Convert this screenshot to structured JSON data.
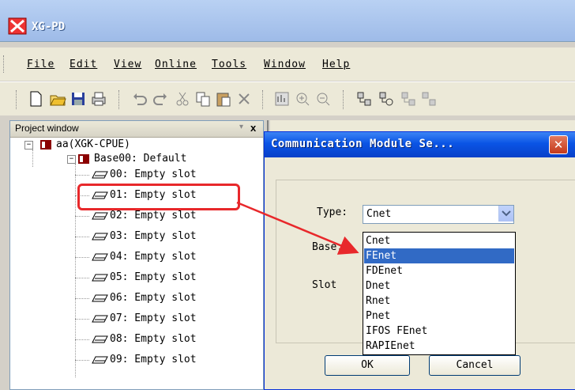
{
  "app": {
    "title": "XG-PD"
  },
  "menu": [
    "File",
    "Edit",
    "View",
    "Online",
    "Tools",
    "Window",
    "Help"
  ],
  "toolbar_icons": [
    "new-file-icon",
    "open-folder-icon",
    "save-icon",
    "print-icon",
    "undo-icon",
    "redo-icon",
    "cut-icon",
    "copy-icon",
    "paste-icon",
    "delete-icon",
    "monitor-icon",
    "zoom-in-icon",
    "zoom-out-icon",
    "network-icon",
    "network-search-icon",
    "network-config-icon",
    "network-extra-icon"
  ],
  "project_window": {
    "title": "Project window",
    "pin_glyph": "▾",
    "close_glyph": "x",
    "root": {
      "expander": "−",
      "label": "aa(XGK-CPUE)"
    },
    "base": {
      "expander": "−",
      "label": "Base00: Default"
    },
    "slots": [
      "00: Empty slot",
      "01: Empty slot",
      "02: Empty slot",
      "03: Empty slot",
      "04: Empty slot",
      "05: Empty slot",
      "06: Empty slot",
      "07: Empty slot",
      "08: Empty slot",
      "09: Empty slot"
    ]
  },
  "dialog": {
    "title": "Communication Module Se...",
    "close_glyph": "✕",
    "type_label": "Type:",
    "base_label": "Base:",
    "slot_label": "Slot",
    "type_value": "Cnet",
    "options": [
      "Cnet",
      "FEnet",
      "FDEnet",
      "Dnet",
      "Rnet",
      "Pnet",
      "IFOS FEnet",
      "RAPIEnet"
    ],
    "selected_option": "FEnet",
    "ok_label": "OK",
    "cancel_label": "Cancel"
  },
  "colors": {
    "highlight_red": "#e8282b",
    "selection_blue": "#316ac5",
    "dialog_blue": "#0a54e5"
  }
}
